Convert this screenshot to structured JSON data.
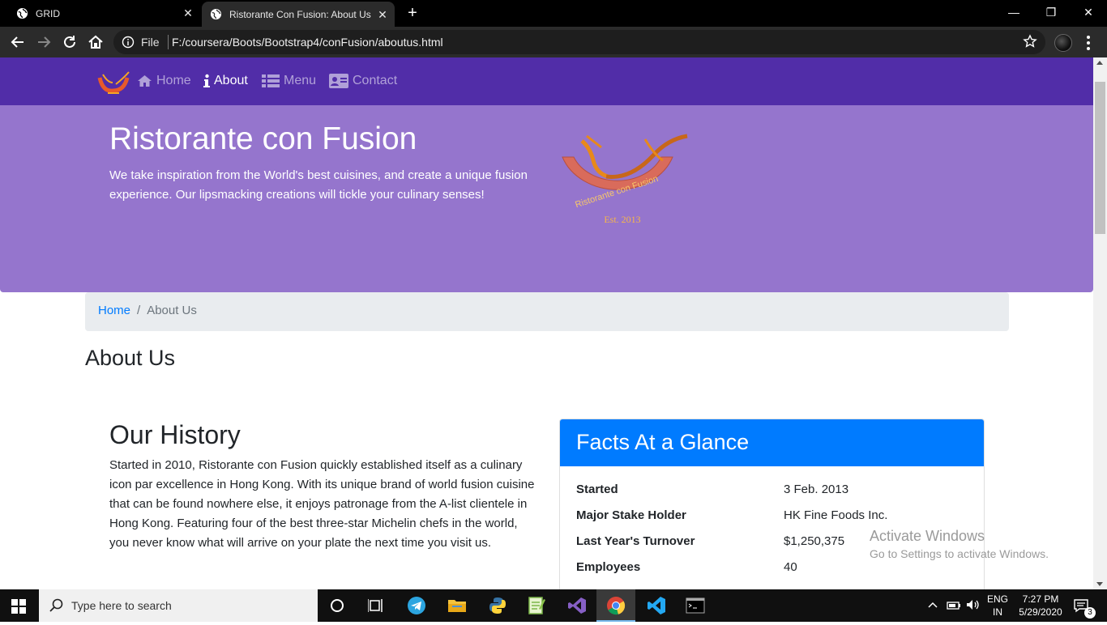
{
  "browser": {
    "tabs": [
      {
        "title": "GRID",
        "close": "✕"
      },
      {
        "title": "Ristorante Con Fusion: About Us",
        "close": "✕"
      }
    ],
    "new_tab": "+",
    "window_controls": {
      "minimize": "—",
      "restore": "❐",
      "close": "✕"
    },
    "address": {
      "scheme_label": "File",
      "url": "F:/coursera/Boots/Bootstrap4/conFusion/aboutus.html"
    }
  },
  "site": {
    "nav": [
      {
        "label": "Home",
        "icon": "home-icon"
      },
      {
        "label": "About",
        "icon": "info-icon",
        "active": true
      },
      {
        "label": "Menu",
        "icon": "list-icon"
      },
      {
        "label": "Contact",
        "icon": "address-card-icon"
      }
    ],
    "jumbotron": {
      "title": "Ristorante con Fusion",
      "text": "We take inspiration from the World's best cuisines, and create a unique fusion experience. Our lipsmacking creations will tickle your culinary senses!",
      "logo_text": "Ristorante con Fusion",
      "logo_est": "Est. 2013"
    },
    "breadcrumb": {
      "home": "Home",
      "separator": "/",
      "current": "About Us"
    },
    "page_title": "About Us",
    "history": {
      "title": "Our History",
      "text": "Started in 2010, Ristorante con Fusion quickly established itself as a culinary icon par excellence in Hong Kong. With its unique brand of world fusion cuisine that can be found nowhere else, it enjoys patronage from the A-list clientele in Hong Kong. Featuring four of the best three-star Michelin chefs in the world, you never know what will arrive on your plate the next time you visit us."
    },
    "facts": {
      "title": "Facts At a Glance",
      "rows": [
        {
          "label": "Started",
          "value": "3 Feb. 2013"
        },
        {
          "label": "Major Stake Holder",
          "value": "HK Fine Foods Inc."
        },
        {
          "label": "Last Year's Turnover",
          "value": "$1,250,375"
        },
        {
          "label": "Employees",
          "value": "40"
        }
      ]
    },
    "colors": {
      "navbar": "#512DA8",
      "jumbotron": "#9575CD",
      "card_header": "#007bff",
      "link": "#007bff"
    }
  },
  "watermark": {
    "line1": "Activate Windows",
    "line2": "Go to Settings to activate Windows."
  },
  "taskbar": {
    "search_placeholder": "Type here to search",
    "apps": [
      "cortana-icon",
      "task-view-icon",
      "telegram-icon",
      "file-explorer-icon",
      "python-icon",
      "notepad-plus-icon",
      "visual-studio-icon",
      "chrome-icon",
      "vscode-icon",
      "terminal-icon"
    ],
    "lang_line1": "ENG",
    "lang_line2": "IN",
    "time": "7:27 PM",
    "date": "5/29/2020",
    "notification_count": "3"
  }
}
